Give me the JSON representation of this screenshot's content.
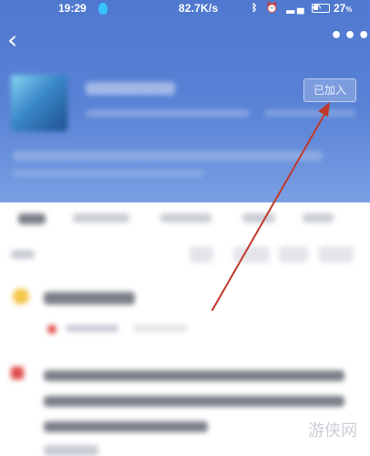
{
  "status_bar": {
    "time": "19:29",
    "network_speed": "82.7K/s",
    "battery_percent": "27"
  },
  "nav": {
    "back_icon": "chevron-left-icon",
    "more_icon": "more-dots-icon"
  },
  "group": {
    "join_button_label": "已加入"
  },
  "colors": {
    "header_blue": "#5a83d6",
    "annotation_arrow": "#c0392b"
  }
}
